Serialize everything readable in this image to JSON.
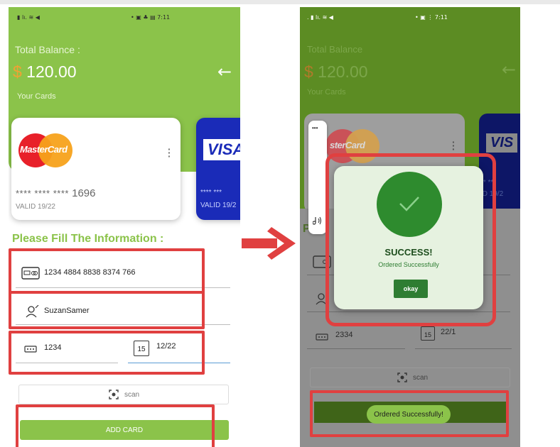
{
  "left_screen": {
    "status_left": "▮ lı. ≋ ◀",
    "status_right": "• ▣ ♣ ▤ 7:11",
    "total_balance_label": "Total Balance :",
    "currency_symbol": "$",
    "balance_amount": " 120.00",
    "your_cards_label": "Your Cards",
    "back_arrow": "←",
    "mastercard": {
      "brand": "MasterCard",
      "masked": "**** **** ****",
      "last4": "1696",
      "valid": "VALID 19/22"
    },
    "visa_card": {
      "brand": "VISA",
      "masked": "**** ***",
      "valid": "VALID 19/2"
    },
    "form_title": "Please Fill The Information :",
    "card_number_value": "1234 4884 8838 8374 766",
    "name_value": "SuzanSamer",
    "cvv_value": "1234",
    "expiry_value": "12/22",
    "calendar_day": "15",
    "scan_label": "scan",
    "add_card_label": "ADD CARD"
  },
  "right_screen": {
    "status_left": ". ▮ lı. ≋ ◀",
    "status_right": "• ▣ ⋮ 7:11",
    "total_balance_label": "Total Balance",
    "currency_symbol": "$",
    "balance_amount": " 120.00",
    "your_cards_label": "Your Cards",
    "back_arrow": "←",
    "mastercard_brand": "sterCard",
    "visa_brand": "VIS",
    "visa_masked": "** ***",
    "visa_valid": "ID 19/2",
    "form_title_fragment": "P",
    "cvv_value": "2334",
    "expiry_value": "22/1",
    "calendar_day": "15",
    "scan_label": "scan",
    "toast_text": "Ordered Successfully!",
    "panel_dots": "•••",
    "dialog": {
      "title": "SUCCESS!",
      "message": "Ordered Successfully",
      "button_label": "okay"
    }
  },
  "colors": {
    "primary_green": "#8bc34a",
    "dark_green": "#2e7d32",
    "highlight_red": "#e04040",
    "visa_blue": "#1a2bb8",
    "mastercard_red": "#e8202a",
    "mastercard_orange": "#f7a21b"
  },
  "icons": [
    "card-icon",
    "user-icon",
    "cvv-icon",
    "calendar-icon",
    "scan-icon",
    "back-arrow-icon",
    "check-icon",
    "more-vert-icon",
    "sound-icon",
    "right-arrow-icon"
  ]
}
